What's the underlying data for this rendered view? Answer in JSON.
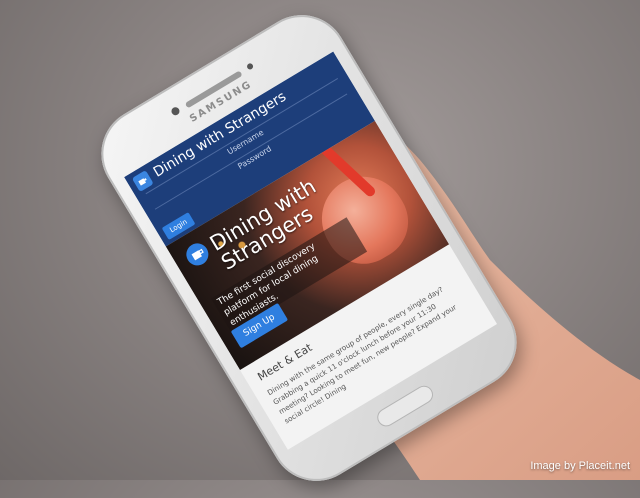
{
  "phone": {
    "brand": "SAMSUNG"
  },
  "app": {
    "title": "Dining with Strangers",
    "username_placeholder": "Username",
    "password_placeholder": "Password",
    "login_label": "Login",
    "logo_icon": "app-logo-icon",
    "accent_color": "#2f7fe0",
    "navbar_color": "#1d3e7a"
  },
  "hero": {
    "title": "Dining with Strangers",
    "tagline": "The first social discovery platform for local dining enthusiasts.",
    "signup_label": "Sign Up",
    "icon": "coffee-cup-icon"
  },
  "section": {
    "title": "Meet & Eat",
    "body": "Dining with the same group of people, every single day? Grabbing a quick 11 o'clock lunch before your 11:30 meeting? Looking to meet fun, new people? Expand your social circle! Dining"
  },
  "credit": "Image by Placeit.net"
}
